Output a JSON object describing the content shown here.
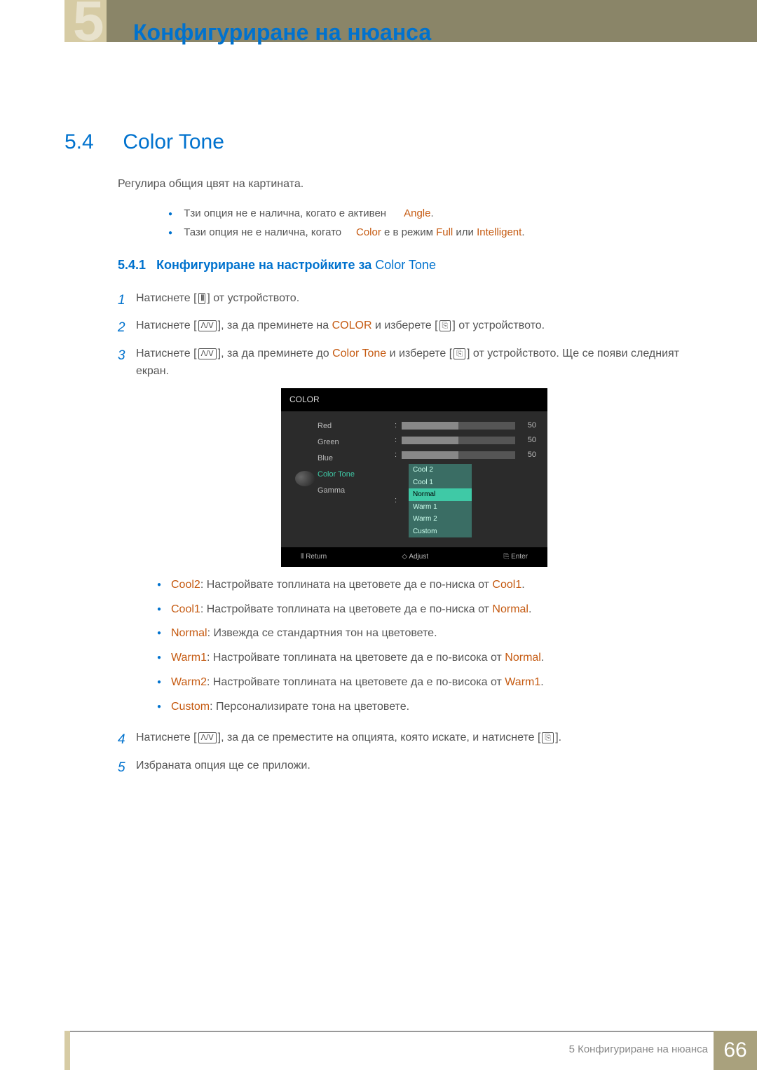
{
  "chapter": {
    "num": "5",
    "title": "Конфигуриране на нюанса"
  },
  "section": {
    "num": "5.4",
    "title": "Color Tone"
  },
  "intro": "Регулира общия цвят на картината.",
  "warnings": {
    "w1_pre": "Тзи опция не е налична, когато е активен",
    "w1_hl": "Angle",
    "w1_post": ".",
    "w2_pre": "Тази опция не е налична, когато ",
    "w2_hl1": "Color",
    "w2_mid": " е в режим ",
    "w2_hl2": "Full",
    "w2_mid2": " или ",
    "w2_hl3": "Intelligent",
    "w2_post": "."
  },
  "subsection": {
    "num": "5.4.1",
    "title_pre": "Конфигуриране на настройките за ",
    "title_hl": "Color Tone"
  },
  "steps": {
    "s1": {
      "num": "1",
      "pre": "Натиснете [",
      "post": "] от устройството."
    },
    "s2": {
      "num": "2",
      "pre": "Натиснете [",
      "mid1": "], за да преминете на ",
      "hl": "COLOR",
      "mid2": " и изберете [",
      "post": "] от устройството."
    },
    "s3": {
      "num": "3",
      "pre": "Натиснете [",
      "mid1": "], за да преминете до ",
      "hl": "Color Tone",
      "mid2": " и изберете [",
      "post": "] от устройството. Ще се появи следният екран."
    },
    "s4": {
      "num": "4",
      "pre": "Натиснете [",
      "mid": "], за да се преместите на опцията, която искате, и натиснете [",
      "post": "]."
    },
    "s5": {
      "num": "5",
      "text": "Избраната опция ще се приложи."
    }
  },
  "osd": {
    "title": "COLOR",
    "labels": {
      "red": "Red",
      "green": "Green",
      "blue": "Blue",
      "tone": "Color Tone",
      "gamma": "Gamma"
    },
    "vals": {
      "red": "50",
      "green": "50",
      "blue": "50"
    },
    "options": {
      "o1": "Cool 2",
      "o2": "Cool 1",
      "o3": "Normal",
      "o4": "Warm 1",
      "o5": "Warm 2",
      "o6": "Custom"
    },
    "footer": {
      "ret": "Return",
      "adj": "Adjust",
      "ent": "Enter"
    }
  },
  "descriptions": {
    "d1": {
      "k": "Cool2",
      "pre": ": Настройвате топлината на цветовете да е по-ниска от ",
      "ref": "Cool1",
      "post": "."
    },
    "d2": {
      "k": "Cool1",
      "pre": ": Настройвате топлината на цветовете да е по-ниска от ",
      "ref": "Normal",
      "post": "."
    },
    "d3": {
      "k": "Normal",
      "pre": ": Извежда се стандартния тон на цветовете."
    },
    "d4": {
      "k": "Warm1",
      "pre": ": Настройвате топлината на цветовете да е по-висока от ",
      "ref": "Normal",
      "post": "."
    },
    "d5": {
      "k": "Warm2",
      "pre": ": Настройвате топлината на цветовете да е по-висока от ",
      "ref": "Warm1",
      "post": "."
    },
    "d6": {
      "k": "Custom",
      "pre": ": Персонализирате тона на цветовете."
    }
  },
  "footer": {
    "text": "5 Конфигуриране на нюанса",
    "page": "66"
  },
  "icons": {
    "menu": "⦀",
    "updown": "ᐱ/ᐯ",
    "enter": "⎘",
    "diamond": "◇",
    "ret_enter": "⏎"
  }
}
